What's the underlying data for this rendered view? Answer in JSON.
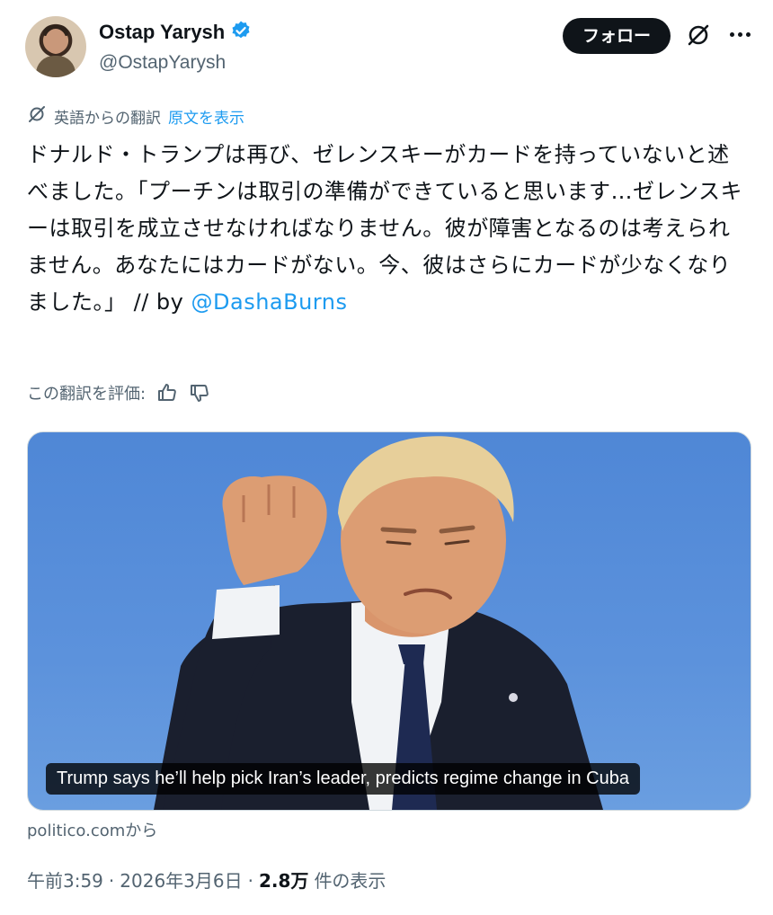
{
  "author": {
    "display_name": "Ostap Yarysh",
    "handle": "@OstapYarysh",
    "verified_icon": "verified-badge-icon"
  },
  "actions": {
    "follow_label": "フォロー",
    "grok_icon": "grok-icon",
    "more_icon": "more-icon"
  },
  "translation": {
    "notice": "英語からの翻訳",
    "show_original": "原文を表示"
  },
  "tweet": {
    "text": "ドナルド・トランプは再び、ゼレンスキーがカードを持っていないと述べました。「プーチンは取引の準備ができていると思います…ゼレンスキーは取引を成立させなければなりません。彼が障害となるのは考えられません。あなたにはカードがない。今、彼はさらにカードが少なくなりました。」 // by ",
    "mention": "@DashaBurns"
  },
  "rating": {
    "label": "この翻訳を評価:"
  },
  "card": {
    "caption": "Trump says he’ll help pick Iran’s leader, predicts regime change in Cuba",
    "source": "politico.comから"
  },
  "meta": {
    "time": "午前3:59",
    "separator": "·",
    "date": "2026年3月6日",
    "views_count": "2.8万",
    "views_label": "件の表示"
  },
  "colors": {
    "link": "#1d9bf0",
    "secondary": "#536471",
    "text": "#0f1419"
  }
}
